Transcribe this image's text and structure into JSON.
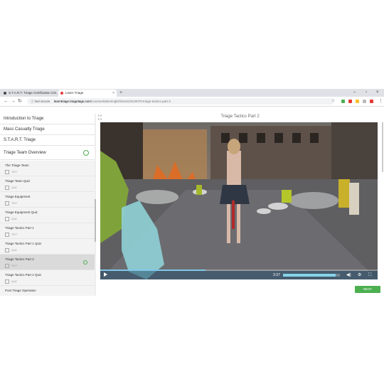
{
  "tabs": [
    {
      "label": "S.T.A.R.T. Triage Certification Co..."
    },
    {
      "label": "Learn Triage"
    }
  ],
  "address": {
    "security": "Not secure",
    "domain": "learntriage.triagetags.com",
    "path": "/courses/take/english/texts/2018079-triage-tactics-part-2"
  },
  "sidebar": {
    "sections": [
      {
        "label": "Introduction to Triage"
      },
      {
        "label": "Mass Casualty Triage"
      },
      {
        "label": "S.T.A.R.T. Triage"
      },
      {
        "label": "Triage Team Overview"
      }
    ],
    "lessons": [
      {
        "title": "The Triage Team",
        "type": "TEXT"
      },
      {
        "title": "Triage Team Quiz",
        "type": "QUIZ"
      },
      {
        "title": "Triage Equipment",
        "type": "TEXT"
      },
      {
        "title": "Triage Equipment Quiz",
        "type": "QUIZ"
      },
      {
        "title": "Triage Tactics Part 1",
        "type": "TEXT"
      },
      {
        "title": "Triage Tactics Part 1 Quiz",
        "type": "QUIZ"
      },
      {
        "title": "Triage Tactics Part 2",
        "type": "TEXT"
      },
      {
        "title": "Triage Tactics Part 2 Quiz",
        "type": "QUIZ"
      },
      {
        "title": "Post Triage Operation",
        "type": ""
      }
    ]
  },
  "video": {
    "title": "Triage Tactics Part 2",
    "time": "3:37",
    "progress": 0.38,
    "volume": 0.92
  },
  "next_label": "NEXT"
}
